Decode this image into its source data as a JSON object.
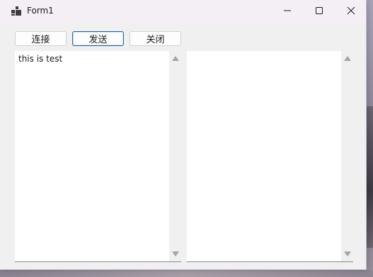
{
  "window": {
    "title": "Form1",
    "icon": "winforms-app-icon",
    "controls": {
      "minimize_icon": "minimize-icon",
      "maximize_icon": "maximize-icon",
      "close_icon": "close-icon"
    }
  },
  "toolbar": {
    "connect_label": "连接",
    "send_label": "发送",
    "close_label": "关闭"
  },
  "send_textbox": {
    "value": "this is test"
  },
  "receive_textbox": {
    "value": ""
  },
  "colors": {
    "focused_button_border": "#1b6a9c",
    "window_background": "#f0f0f0"
  }
}
